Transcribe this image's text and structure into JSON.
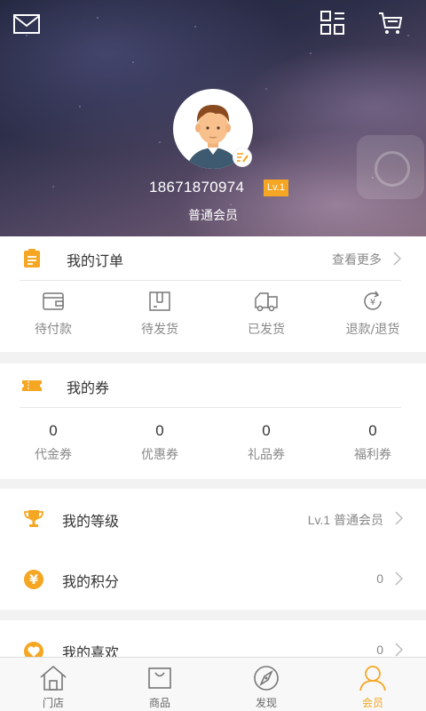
{
  "header": {
    "phone": "18671870974",
    "level_badge": "Lv.1",
    "member_type": "普通会员"
  },
  "orders": {
    "title": "我的订单",
    "more": "查看更多",
    "items": [
      {
        "label": "待付款",
        "icon": "wallet-icon"
      },
      {
        "label": "待发货",
        "icon": "box-icon"
      },
      {
        "label": "已发货",
        "icon": "truck-icon"
      },
      {
        "label": "退款/退货",
        "icon": "refund-icon"
      }
    ]
  },
  "coupons": {
    "title": "我的券",
    "items": [
      {
        "count": "0",
        "label": "代金券"
      },
      {
        "count": "0",
        "label": "优惠券"
      },
      {
        "count": "0",
        "label": "礼品券"
      },
      {
        "count": "0",
        "label": "福利券"
      }
    ]
  },
  "rows": [
    {
      "title": "我的等级",
      "value": "Lv.1 普通会员",
      "icon": "trophy-icon"
    },
    {
      "title": "我的积分",
      "value": "0",
      "icon": "yen-coin-icon"
    },
    {
      "title": "我的喜欢",
      "value": "0",
      "icon": "heart-icon"
    }
  ],
  "nav": {
    "tabs": [
      {
        "label": "门店",
        "icon": "store-icon"
      },
      {
        "label": "商品",
        "icon": "shopping-bag-icon"
      },
      {
        "label": "发现",
        "icon": "compass-icon"
      },
      {
        "label": "会员",
        "icon": "user-icon"
      }
    ],
    "active_index": 3
  },
  "colors": {
    "accent": "#f5a623",
    "text_dark": "#333333",
    "text_gray": "#888888"
  }
}
